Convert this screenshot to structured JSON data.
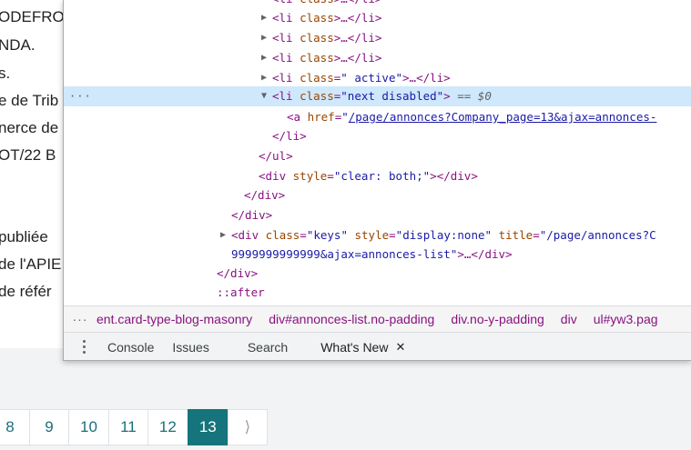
{
  "page": {
    "lines": [
      "ODEFRO",
      "NDA.",
      "s.",
      "e de Trib",
      "nerce de",
      "OT/22 B",
      "publiée",
      "de l'APIE",
      "de référ"
    ],
    "pagination": {
      "pages": [
        "8",
        "9",
        "10",
        "11",
        "12",
        "13"
      ],
      "active": "13",
      "next_icon": "⟩"
    }
  },
  "devtools": {
    "tree": {
      "li1": {
        "tag_open": "<li ",
        "attr": "class",
        "eq": ">…</li>",
        "pre": ""
      },
      "li_class": "class",
      "li_collapsed": ">…</li>",
      "li_active_val": "\" active\"",
      "li_selected_val": "\"next disabled\"",
      "eq0": "== $0",
      "a_href_attr": "href",
      "a_href_val": "/page/annonces?Company_page=13&ajax=annonces-",
      "close_li": "</li>",
      "close_ul": "</ul>",
      "div_clear_style_attr": "style",
      "div_clear_style_val": "\"clear: both;\"",
      "close_div": "</div>",
      "keys_class_val": "\"keys\"",
      "keys_style_val": "\"display:none\"",
      "keys_title_attr": "title",
      "keys_title_val": "\"/page/annonces?C",
      "keys_cont": "9999999999999&ajax=annonces-list\"",
      "keys_end": ">…</div>",
      "after": "::after"
    },
    "breadcrumbs": [
      "ent.card-type-blog-masonry",
      "div#annonces-list.no-padding",
      "div.no-y-padding",
      "div",
      "ul#yw3.pag"
    ],
    "drawer_tabs": [
      "Console",
      "Issues",
      "Search",
      "What's New"
    ],
    "active_drawer_tab": "What's New"
  }
}
